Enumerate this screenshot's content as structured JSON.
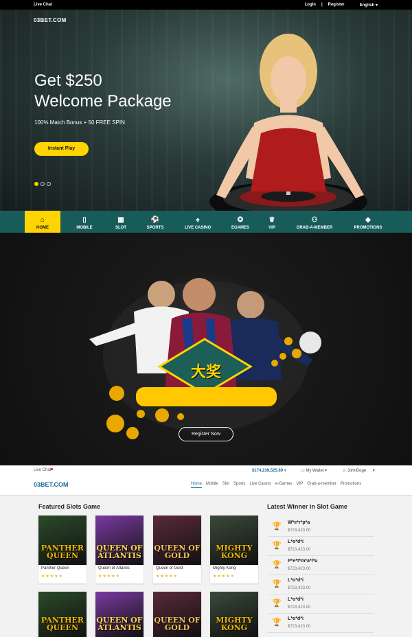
{
  "topbar": {
    "live_chat": "Live Chat",
    "login": "Login",
    "separator": "|",
    "register": "Register",
    "language": "English"
  },
  "hero": {
    "logo": "03BET.COM",
    "title_line1": "Get $250",
    "title_line2": "Welcome Package",
    "subtitle": "100% Match Bonus + 50 FREE SPIN",
    "cta": "Instant Play",
    "slide_count": 3,
    "active_slide": 1
  },
  "nav": [
    {
      "label": "HOME",
      "icon": "home-icon",
      "glyph": "⌂"
    },
    {
      "label": "MOBILE",
      "icon": "mobile-icon",
      "glyph": "▯"
    },
    {
      "label": "SLOT",
      "icon": "slot-icon",
      "glyph": "▦"
    },
    {
      "label": "SPORTS",
      "icon": "sports-icon",
      "glyph": "⚽"
    },
    {
      "label": "LIVE CASINO",
      "icon": "live-casino-icon",
      "glyph": "♠"
    },
    {
      "label": "EGAMES",
      "icon": "egames-icon",
      "glyph": "✪"
    },
    {
      "label": "VIP",
      "icon": "vip-icon",
      "glyph": "♛"
    },
    {
      "label": "GRAB-A-MEMBER",
      "icon": "grab-a-member-icon",
      "glyph": "⚇"
    },
    {
      "label": "PROMOTIONS",
      "icon": "promotions-icon",
      "glyph": "◆"
    }
  ],
  "promo": {
    "badge_text": "大奖",
    "cta": "Register Now"
  },
  "site_header": {
    "live_chat": "Live Chat",
    "balance": "$174,239,525.89",
    "wallet": "My Wallet",
    "user": "JohnDoge",
    "logo": "03BET.COM",
    "menu": [
      "Home",
      "Mobile",
      "Slot",
      "Sports",
      "Live Casino",
      "e-Games",
      "VIP",
      "Grab-a-member",
      "Promotions"
    ]
  },
  "featured": {
    "title": "Featured Slots Game",
    "games": [
      {
        "name": "Panther Queen",
        "art_text": "PANTHER QUEEN",
        "rating": 4,
        "bg": "#2b4a2a",
        "fg": "#f0b400"
      },
      {
        "name": "Queen of Atlantis",
        "art_text": "QUEEN OF ATLANTIS",
        "rating": 4,
        "bg": "#7a3aa0",
        "fg": "#ffd84a"
      },
      {
        "name": "Queen of Gold",
        "art_text": "QUEEN OF GOLD",
        "rating": 4,
        "bg": "#5a2a3a",
        "fg": "#f4c35a"
      },
      {
        "name": "Mighty Kong",
        "art_text": "MIGHTY KONG",
        "rating": 4,
        "bg": "#3a4a3a",
        "fg": "#f0b400"
      }
    ]
  },
  "winners": {
    "title": "Latest Winner in Slot Game",
    "list": [
      {
        "name": "W*e*r*p*a",
        "amount": "$723,423.00",
        "cup": "gold"
      },
      {
        "name": "L*o*d*i",
        "amount": "$723,423.00",
        "cup": "silver"
      },
      {
        "name": "P*e*t*m*a*l*u",
        "amount": "$723,423.00",
        "cup": "bronze"
      },
      {
        "name": "L*o*d*i",
        "amount": "$723,423.00",
        "cup": "bronze"
      },
      {
        "name": "L*o*d*i",
        "amount": "$723,423.00",
        "cup": "bronze"
      },
      {
        "name": "L*o*d*i",
        "amount": "$723,423.00",
        "cup": "bronze"
      }
    ]
  },
  "colors": {
    "accent_yellow": "#ffd400",
    "nav_teal": "#185c5a",
    "brand_blue": "#1c6a9c"
  }
}
